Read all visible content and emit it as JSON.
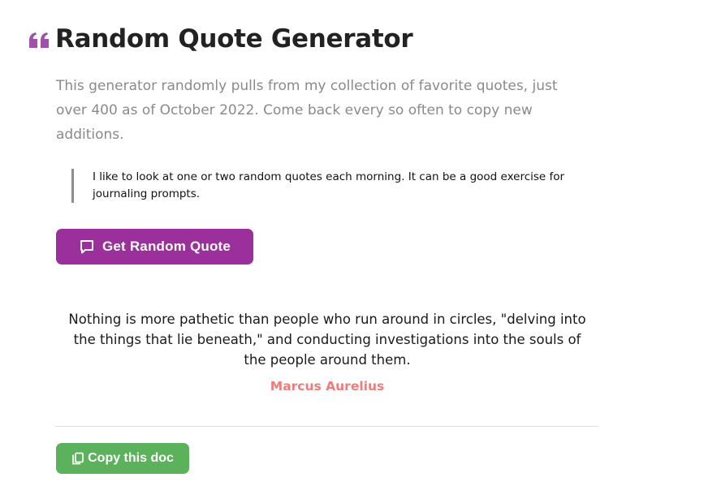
{
  "header": {
    "icon": "quote-icon",
    "title": "Random Quote Generator"
  },
  "intro": {
    "text": "This generator randomly pulls from my collection of favorite quotes, just over 400 as of October 2022. Come back every so often to copy new additions."
  },
  "note": {
    "text": "I like to look at one or two random quotes each morning. It can be a good exercise for journaling prompts."
  },
  "get_button": {
    "icon": "speech-bubble-icon",
    "label": "Get Random Quote"
  },
  "quote": {
    "text": "Nothing is more pathetic than people who run around in circles, \"delving into the things that lie beneath,\" and conducting investigations into the souls of the people around them.",
    "author": "Marcus Aurelius"
  },
  "copy_button": {
    "icon": "copy-icon",
    "label": "Copy this doc"
  },
  "colors": {
    "accent_purple": "#9b2f9b",
    "quote_icon": "#a150a8",
    "author": "#ef7b7b",
    "copy_green": "#5cb25c",
    "intro_gray": "#8a8a8a"
  }
}
